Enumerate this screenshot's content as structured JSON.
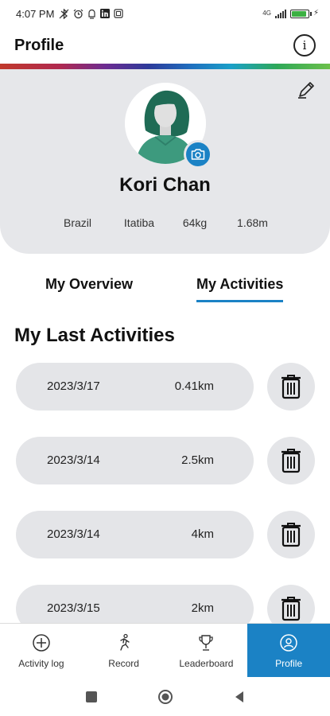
{
  "status_bar": {
    "time": "4:07 PM",
    "network": "4G",
    "icons": [
      "bluetooth-off-icon",
      "alarm-icon",
      "app-notification-icon",
      "linkedin-icon",
      "screenshot-icon"
    ],
    "battery_level": 0.9,
    "battery_color": "#3cb043"
  },
  "header": {
    "title": "Profile",
    "info_icon": "info-icon"
  },
  "profile": {
    "name": "Kori Chan",
    "country": "Brazil",
    "city": "Itatiba",
    "weight": "64kg",
    "height": "1.68m",
    "edit_icon": "pencil-icon",
    "camera_icon": "camera-icon"
  },
  "tabs": [
    {
      "label": "My Overview",
      "active": false
    },
    {
      "label": "My Activities",
      "active": true
    }
  ],
  "activities": {
    "title": "My Last Activities",
    "items": [
      {
        "date": "2023/3/17",
        "distance": "0.41km"
      },
      {
        "date": "2023/3/14",
        "distance": "2.5km"
      },
      {
        "date": "2023/3/14",
        "distance": "4km"
      },
      {
        "date": "2023/3/15",
        "distance": "2km"
      }
    ],
    "delete_icon": "trash-icon"
  },
  "bottom_nav": [
    {
      "label": "Activity log",
      "icon": "add-circle-icon",
      "active": false
    },
    {
      "label": "Record",
      "icon": "running-person-icon",
      "active": false
    },
    {
      "label": "Leaderboard",
      "icon": "trophy-icon",
      "active": false
    },
    {
      "label": "Profile",
      "icon": "user-circle-icon",
      "active": true
    }
  ],
  "colors": {
    "accent": "#1b82c5",
    "card_background": "#e6e7ea"
  }
}
